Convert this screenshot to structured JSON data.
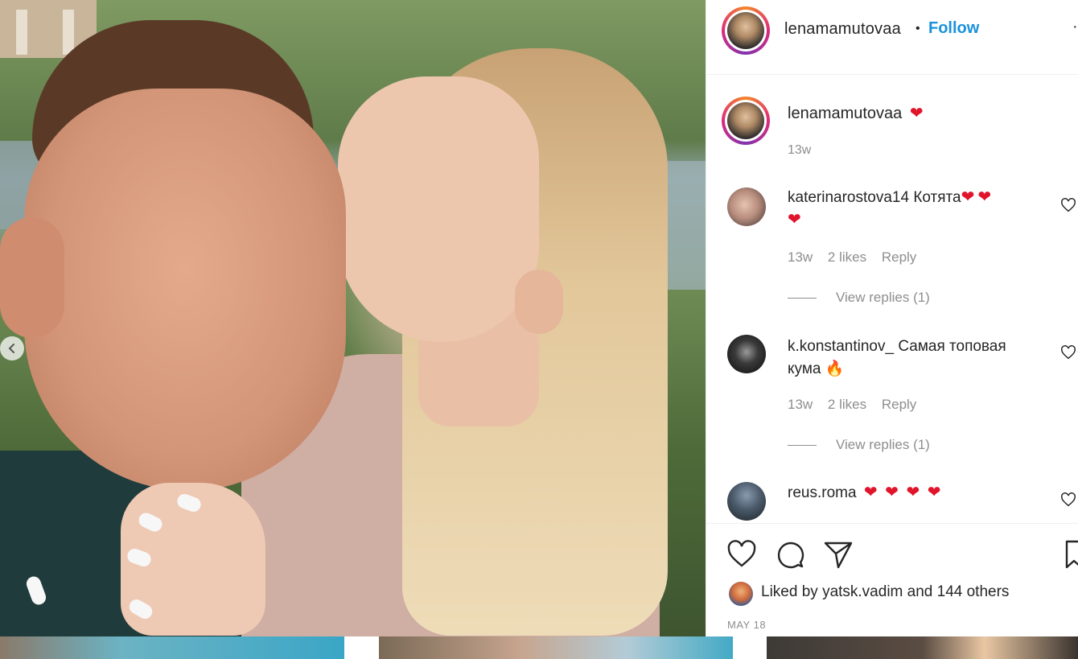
{
  "header": {
    "username": "lenamamutovaa",
    "separator": "•",
    "follow_label": "Follow",
    "more_label": "·"
  },
  "caption": {
    "username": "lenamamutovaa",
    "emoji": "❤",
    "time": "13w"
  },
  "comments": [
    {
      "username": "katerinarostova14",
      "text": "Котята",
      "emoji_line1": "❤❤",
      "emoji_line2": "❤",
      "time": "13w",
      "likes": "2 likes",
      "reply_label": "Reply",
      "view_replies": "View replies (1)"
    },
    {
      "username": "k.konstantinov_",
      "text": "Самая топовая",
      "text_line2": "кума",
      "emoji_line2": "🔥",
      "time": "13w",
      "likes": "2 likes",
      "reply_label": "Reply",
      "view_replies": "View replies (1)"
    },
    {
      "username": "reus.roma",
      "emoji": "❤ ❤ ❤ ❤"
    }
  ],
  "likes": {
    "prefix": "Liked by",
    "user": "yatsk.vadim",
    "middle": "and",
    "others": "144 others"
  },
  "post_date": "MAY 18",
  "icons": {
    "carousel_prev": "chevron-left-icon",
    "like": "heart-outline-icon",
    "comment": "speech-bubble-icon",
    "share": "paper-plane-icon",
    "save": "bookmark-icon",
    "comment_like": "small-heart-icon"
  },
  "colors": {
    "follow": "#1a91da",
    "muted": "#8e8e8e",
    "text": "#262626",
    "heart": "#e0142a"
  }
}
